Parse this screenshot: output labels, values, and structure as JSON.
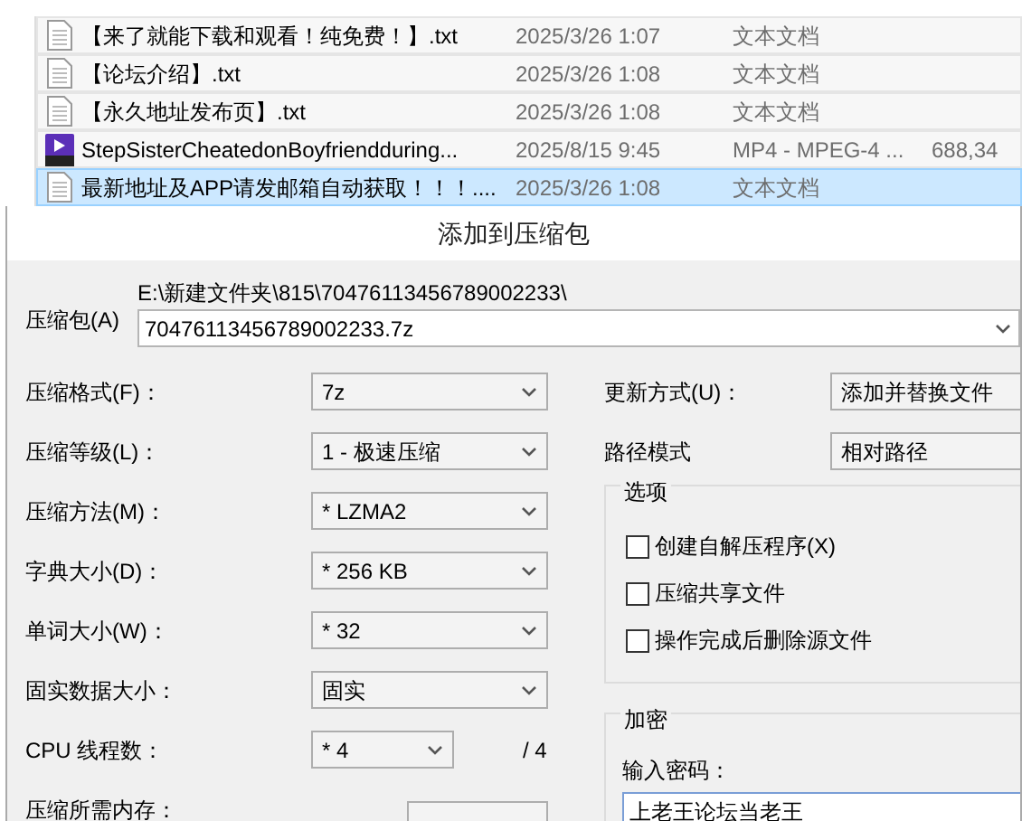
{
  "files": [
    {
      "kind": "text",
      "name": "【来了就能下载和观看！纯免费！】.txt",
      "date": "2025/3/26 1:07",
      "type": "文本文档",
      "selected": false
    },
    {
      "kind": "text",
      "name": "【论坛介绍】.txt",
      "date": "2025/3/26 1:08",
      "type": "文本文档",
      "selected": false
    },
    {
      "kind": "text",
      "name": "【永久地址发布页】.txt",
      "date": "2025/3/26 1:08",
      "type": "文本文档",
      "selected": false
    },
    {
      "kind": "video",
      "name": "StepSisterCheatedonBoyfriendduring...",
      "date": "2025/8/15 9:45",
      "type": "MP4 - MPEG-4 ...",
      "size": "688,34",
      "selected": false
    },
    {
      "kind": "text",
      "name": "最新地址及APP请发邮箱自动获取！！！....",
      "date": "2025/3/26 1:08",
      "type": "文本文档",
      "selected": true
    }
  ],
  "dialog": {
    "title": "添加到压缩包",
    "archive": {
      "label": "压缩包(A)",
      "path": "E:\\新建文件夹\\815\\70476113456789002233\\",
      "value": "70476113456789002233.7z"
    },
    "left_fields": [
      {
        "kind": "select",
        "label": "压缩格式(F)：",
        "value": "7z"
      },
      {
        "kind": "select",
        "label": "压缩等级(L)：",
        "value": "1 - 极速压缩"
      },
      {
        "kind": "select",
        "label": "压缩方法(M)：",
        "value": "* LZMA2"
      },
      {
        "kind": "select",
        "label": "字典大小(D)：",
        "value": "* 256 KB"
      },
      {
        "kind": "select",
        "label": "单词大小(W)：",
        "value": "* 32"
      },
      {
        "kind": "select",
        "label": "固实数据大小：",
        "value": "固实"
      },
      {
        "kind": "narrow",
        "label": "CPU 线程数：",
        "value": "* 4",
        "suffix": "/ 4"
      },
      {
        "kind": "readout",
        "label": "压缩所需内存："
      }
    ],
    "right_fields": [
      {
        "label": "更新方式(U)：",
        "value": "添加并替换文件"
      },
      {
        "label": "路径模式",
        "value": "相对路径"
      }
    ],
    "options": {
      "title": "选项",
      "items": [
        {
          "label": "创建自解压程序(X)",
          "checked": false
        },
        {
          "label": "压缩共享文件",
          "checked": false
        },
        {
          "label": "操作完成后删除源文件",
          "checked": false
        }
      ]
    },
    "encryption": {
      "title": "加密",
      "password_label": "输入密码：",
      "password_value": "上老王论坛当老王"
    }
  }
}
